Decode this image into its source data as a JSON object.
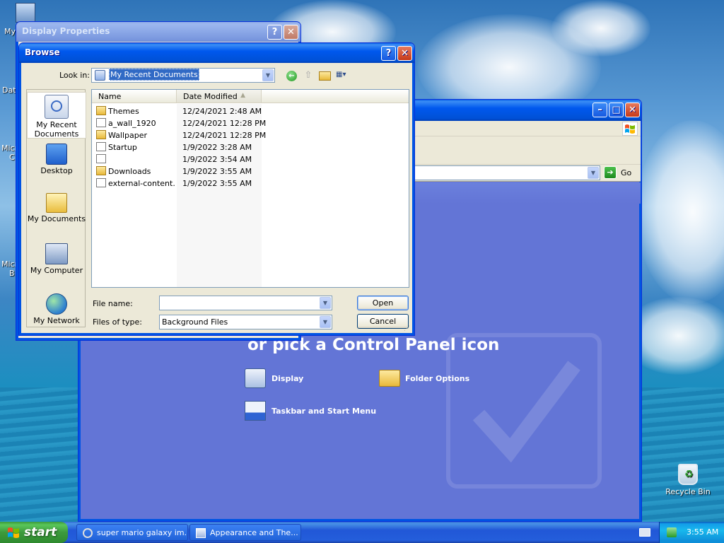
{
  "desktop": {
    "icons": [
      {
        "label": "My",
        "icon": "computer-icon"
      },
      {
        "label": "Date",
        "icon": "date-icon"
      },
      {
        "label": "Micro\nC",
        "icon": "app-icon"
      },
      {
        "label": "Micro\nB",
        "icon": "app-icon"
      },
      {
        "label": "Recycle Bin",
        "icon": "recycle-bin-icon"
      }
    ]
  },
  "display_properties": {
    "title": "Display Properties"
  },
  "control_panel": {
    "heading": "or pick a Control Panel icon",
    "go_label": "Go",
    "links": [
      {
        "label": "Display",
        "icon": "display-icon"
      },
      {
        "label": "Folder Options",
        "icon": "folder-options-icon"
      },
      {
        "label": "Taskbar and Start Menu",
        "icon": "taskbar-icon"
      }
    ]
  },
  "browse": {
    "title": "Browse",
    "look_in_label": "Look in:",
    "look_in_value": "My Recent Documents",
    "places": [
      {
        "label": "My Recent\nDocuments",
        "icon": "recent-documents-icon"
      },
      {
        "label": "Desktop",
        "icon": "desktop-icon"
      },
      {
        "label": "My Documents",
        "icon": "my-documents-icon"
      },
      {
        "label": "My Computer",
        "icon": "my-computer-icon"
      },
      {
        "label": "My Network",
        "icon": "my-network-icon"
      }
    ],
    "columns": {
      "name": "Name",
      "date": "Date Modified"
    },
    "files": [
      {
        "name": "Themes",
        "date": "12/24/2021 2:48 AM",
        "icon": "folder-shortcut-icon"
      },
      {
        "name": "a_wall_1920",
        "date": "12/24/2021 12:28 PM",
        "icon": "file-shortcut-icon"
      },
      {
        "name": "Wallpaper",
        "date": "12/24/2021 12:28 PM",
        "icon": "folder-shortcut-icon"
      },
      {
        "name": "Startup",
        "date": "1/9/2022 3:28 AM",
        "icon": "file-shortcut-icon"
      },
      {
        "name": "",
        "date": "1/9/2022 3:54 AM",
        "icon": "file-shortcut-icon"
      },
      {
        "name": "Downloads",
        "date": "1/9/2022 3:55 AM",
        "icon": "folder-shortcut-icon"
      },
      {
        "name": "external-content...",
        "date": "1/9/2022 3:55 AM",
        "icon": "file-shortcut-icon"
      }
    ],
    "file_name_label": "File name:",
    "file_name_value": "",
    "files_of_type_label": "Files of type:",
    "files_of_type_value": "Background Files",
    "open_label": "Open",
    "cancel_label": "Cancel"
  },
  "taskbar": {
    "start_label": "start",
    "items": [
      {
        "label": "super mario galaxy im...",
        "icon": "browser-icon"
      },
      {
        "label": "Appearance and The...",
        "icon": "control-panel-icon"
      }
    ],
    "clock": "3:55 AM"
  }
}
